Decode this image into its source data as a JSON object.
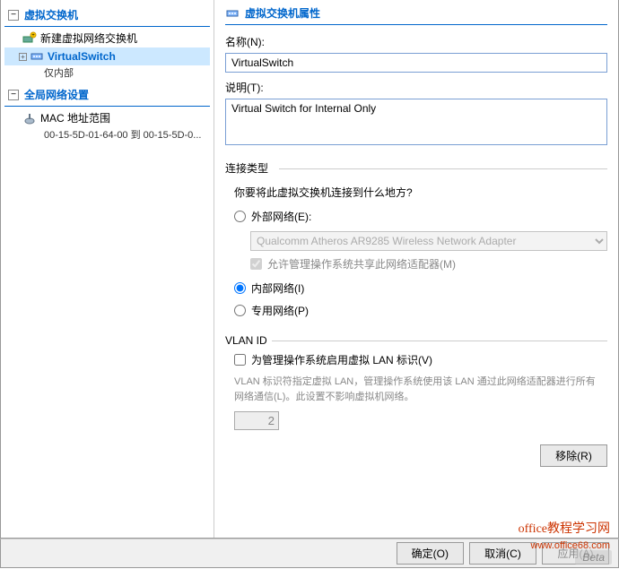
{
  "left": {
    "section1_title": "虚拟交换机",
    "new_switch_label": "新建虚拟网络交换机",
    "selected_switch_name": "VirtualSwitch",
    "selected_switch_type": "仅内部",
    "section2_title": "全局网络设置",
    "mac_range_label": "MAC 地址范围",
    "mac_range_value": "00-15-5D-01-64-00 到 00-15-5D-0..."
  },
  "right": {
    "header": "虚拟交换机属性",
    "name_label": "名称(N):",
    "name_value": "VirtualSwitch",
    "desc_label": "说明(T):",
    "desc_value": "Virtual Switch for Internal Only",
    "conn_type_title": "连接类型",
    "conn_question": "你要将此虚拟交换机连接到什么地方?",
    "radio_external": "外部网络(E):",
    "adapter_selected": "Qualcomm Atheros AR9285 Wireless Network Adapter",
    "allow_mgmt_label": "允许管理操作系统共享此网络适配器(M)",
    "radio_internal": "内部网络(I)",
    "radio_private": "专用网络(P)",
    "vlan_title": "VLAN ID",
    "vlan_enable_label": "为管理操作系统启用虚拟 LAN 标识(V)",
    "vlan_desc": "VLAN 标识符指定虚拟 LAN，管理操作系统使用该 LAN 通过此网络适配器进行所有网络通信(L)。此设置不影响虚拟机网络。",
    "vlan_id_value": "2",
    "remove_label": "移除(R)"
  },
  "footer": {
    "ok": "确定(O)",
    "cancel": "取消(C)",
    "apply": "应用(A)"
  },
  "watermark": {
    "line1": "office教程学习网",
    "line2": "www.office68.com",
    "beta": "Beta"
  }
}
